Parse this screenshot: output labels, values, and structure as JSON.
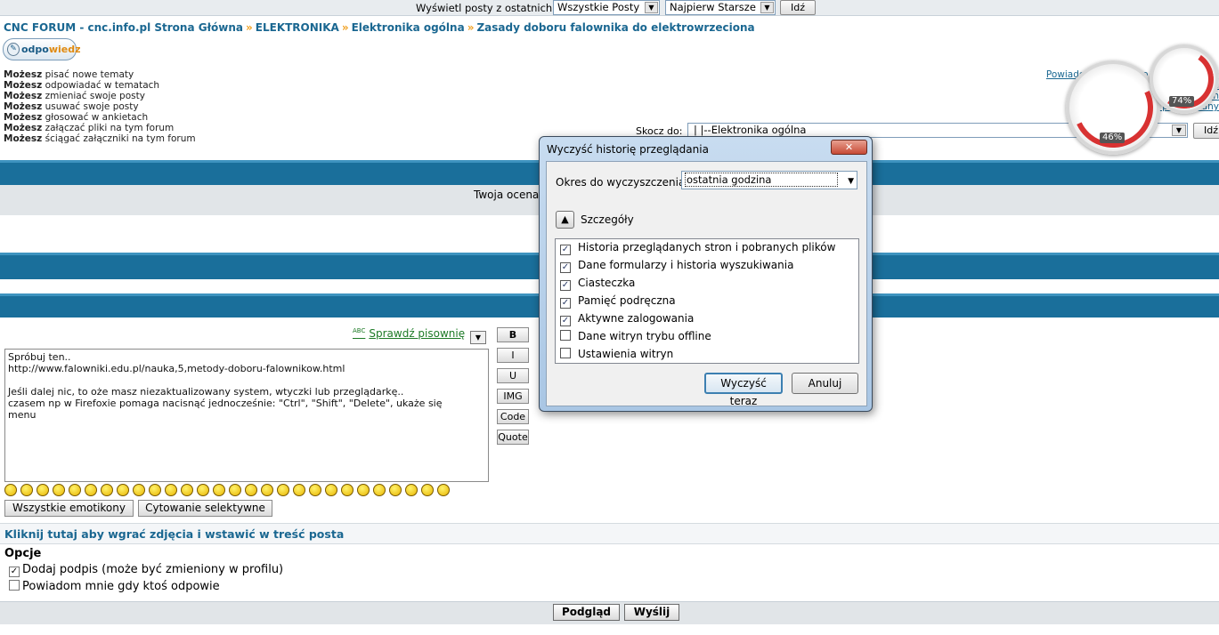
{
  "topbar": {
    "label": "Wyświetl posty z ostatnich:",
    "period_value": "Wszystkie Posty",
    "order_value": "Najpierw Starsze",
    "go_button": "Idź"
  },
  "breadcrumb": {
    "home": "CNC FORUM - cnc.info.pl Strona Główna",
    "separator": "»",
    "level1": "ELEKTRONIKA",
    "level2": "Elektronika ogólna",
    "topic": "Zasady doboru falownika do elektrowrzeciona"
  },
  "reply_button": {
    "prefix": "odpo",
    "suffix": "wiedz"
  },
  "permissions": [
    {
      "bold": "Możesz",
      "text": "pisać nowe tematy"
    },
    {
      "bold": "Możesz",
      "text": "odpowiadać w tematach"
    },
    {
      "bold": "Możesz",
      "text": "zmieniać swoje posty"
    },
    {
      "bold": "Możesz",
      "text": "usuwać swoje posty"
    },
    {
      "bold": "Możesz",
      "text": "głosować w ankietach"
    },
    {
      "bold": "Możesz",
      "text": "załączać pliki na tym forum"
    },
    {
      "bold": "Możesz",
      "text": "ściągać załączniki na tym forum"
    }
  ],
  "right_links": [
    "Powiadom znajomego o tym temacie",
    "Wersja do druku",
    "Dodaj do ulubionych",
    "Oznacz temat jako przeczytany"
  ],
  "jump": {
    "label": "Skocz do:",
    "value": "|   |--Elektronika ogólna",
    "go_button": "Idź"
  },
  "rating_label": "Twoja ocena",
  "editor": {
    "spell_badge": "ABC",
    "spell_link": "Sprawdź pisownię",
    "text": "Spróbuj ten..\nhttp://www.falowniki.edu.pl/nauka,5,metody-doboru-falownikow.html\n\nJeśli dalej nic, to oże masz niezaktualizowany system, wtyczki lub przeglądarkę..\nczasem np w Firefoxie pomaga nacisnąć jednocześnie: \"Ctrl\", \"Shift\", \"Delete\", ukaże się\nmenu",
    "format_buttons": [
      "B",
      "I",
      "U",
      "IMG",
      "Code",
      "Quote"
    ],
    "all_emoticons": "Wszystkie emotikony",
    "selective_quote": "Cytowanie selektywne"
  },
  "upload_link": "Kliknij tutaj aby wgrać zdjęcia i wstawić w treść posta",
  "options": {
    "title": "Opcje",
    "items": [
      {
        "label": "Dodaj podpis (może być zmieniony w profilu)",
        "checked": true
      },
      {
        "label": "Powiadom mnie gdy ktoś odpowie",
        "checked": false
      }
    ]
  },
  "bottom": {
    "preview": "Podgląd",
    "submit": "Wyślij"
  },
  "dialog": {
    "title": "Wyczyść historię przeglądania",
    "period_label": "Okres do wyczyszczenia:",
    "period_value": "ostatnia godzina",
    "details_label": "Szczegóły",
    "items": [
      {
        "label": "Historia przeglądanych stron i pobranych plików",
        "checked": true
      },
      {
        "label": "Dane formularzy i historia wyszukiwania",
        "checked": true
      },
      {
        "label": "Ciasteczka",
        "checked": true
      },
      {
        "label": "Pamięć podręczna",
        "checked": true
      },
      {
        "label": "Aktywne zalogowania",
        "checked": true
      },
      {
        "label": "Dane witryn trybu offline",
        "checked": false
      },
      {
        "label": "Ustawienia witryn",
        "checked": false
      }
    ],
    "clear_button": "Wyczyść teraz",
    "cancel_button": "Anuluj"
  },
  "gadget": {
    "cpu_percent": "46%",
    "mem_percent": "74%"
  },
  "colors": {
    "link_blue": "#1a6791",
    "band_blue": "#1a6f9b",
    "accent_orange": "#f0a020",
    "spell_green": "#1d7a26"
  }
}
